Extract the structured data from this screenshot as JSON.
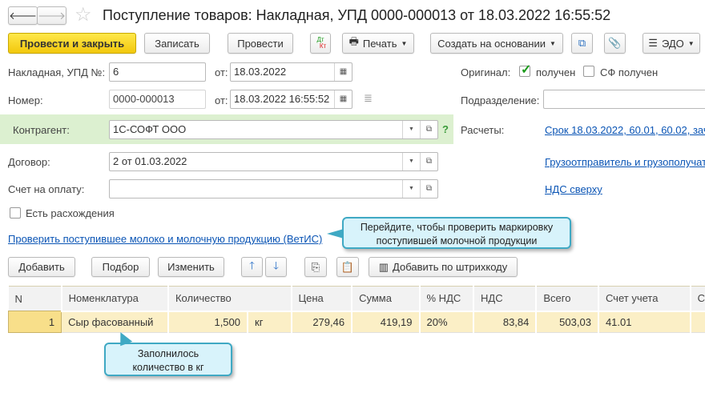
{
  "title": "Поступление товаров: Накладная, УПД 0000-000013 от 18.03.2022 16:55:52",
  "toolbar": {
    "post_close": "Провести и закрыть",
    "save": "Записать",
    "post": "Провести",
    "dtkt_top": "Дт",
    "dtkt_bottom": "Кт",
    "print": "Печать",
    "create_based": "Создать на основании",
    "edo": "ЭДО"
  },
  "form": {
    "invoice_label": "Накладная, УПД №:",
    "invoice_value": "6",
    "from_label": "от:",
    "invoice_date": "18.03.2022",
    "number_label": "Номер:",
    "number_value": "0000-000013",
    "number_date": "18.03.2022 16:55:52",
    "original_label": "Оригинал:",
    "received_label": "получен",
    "sf_received_label": "СФ получен",
    "division_label": "Подразделение:",
    "division_value": "",
    "counterparty_label": "Контрагент:",
    "counterparty_value": "1С-СОФТ ООО",
    "help": "?",
    "settlements_label": "Расчеты:",
    "settlements_link": "Срок 18.03.2022, 60.01, 60.02, зач",
    "contract_label": "Договор:",
    "contract_value": "2 от 01.03.2022",
    "shipper_link": "Грузоотправитель и грузополучат",
    "invoice_pay_label": "Счет на оплату:",
    "invoice_pay_value": "",
    "vat_link": "НДС сверху",
    "discrepancy_label": "Есть расхождения",
    "vetis_link": "Проверить поступившее молоко и молочную продукцию (ВетИС)"
  },
  "callouts": {
    "vetis": "Перейдите, чтобы проверить маркировку поступившей молочной продукции",
    "qty": "Заполнилось количество в кг"
  },
  "table_toolbar": {
    "add": "Добавить",
    "pick": "Подбор",
    "edit": "Изменить",
    "barcode": "Добавить по штрихкоду"
  },
  "table": {
    "headers": [
      "N",
      "Номенклатура",
      "Количество",
      "",
      "Цена",
      "Сумма",
      "% НДС",
      "НДС",
      "Всего",
      "Счет учета",
      "С"
    ],
    "rows": [
      {
        "n": "1",
        "item": "Сыр фасованный",
        "qty": "1,500",
        "unit": "кг",
        "price": "279,46",
        "sum": "419,19",
        "vat_rate": "20%",
        "vat": "83,84",
        "total": "503,03",
        "account": "41.01",
        "extra": ""
      }
    ]
  }
}
